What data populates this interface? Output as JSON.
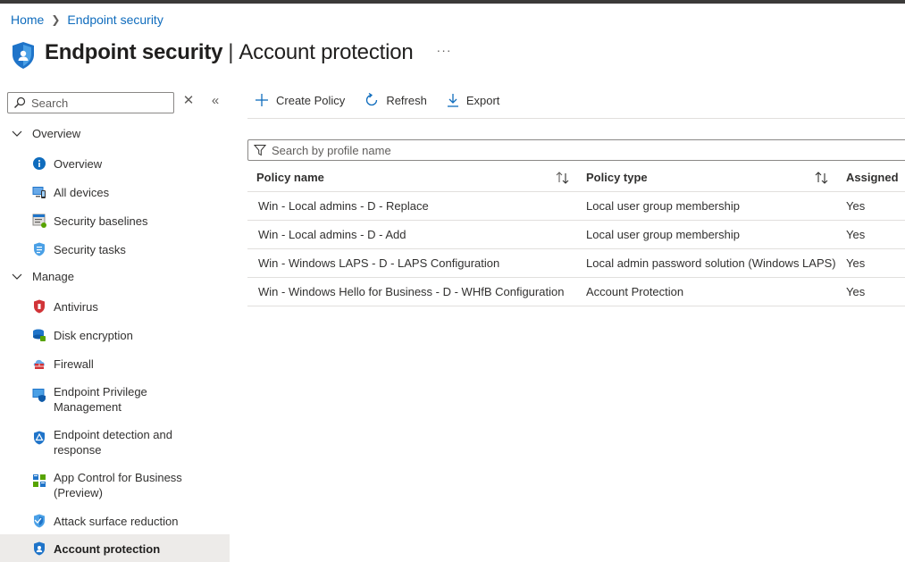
{
  "breadcrumb": {
    "home": "Home",
    "current": "Endpoint security"
  },
  "header": {
    "title": "Endpoint security",
    "subtitle": "Account protection",
    "more": "···"
  },
  "sidebar": {
    "search_placeholder": "Search",
    "groups": {
      "overview": "Overview",
      "manage": "Manage"
    },
    "items": [
      {
        "label": "Overview",
        "icon": "info-icon"
      },
      {
        "label": "All devices",
        "icon": "devices-icon"
      },
      {
        "label": "Security baselines",
        "icon": "baselines-icon"
      },
      {
        "label": "Security tasks",
        "icon": "tasks-icon"
      },
      {
        "label": "Antivirus",
        "icon": "antivirus-icon"
      },
      {
        "label": "Disk encryption",
        "icon": "disk-encryption-icon"
      },
      {
        "label": "Firewall",
        "icon": "firewall-icon"
      },
      {
        "label": "Endpoint Privilege Management",
        "icon": "privilege-icon"
      },
      {
        "label": "Endpoint detection and response",
        "icon": "edr-icon"
      },
      {
        "label": "App Control for Business (Preview)",
        "icon": "app-control-icon"
      },
      {
        "label": "Attack surface reduction",
        "icon": "asr-icon"
      },
      {
        "label": "Account protection",
        "icon": "account-protection-icon"
      }
    ]
  },
  "toolbar": {
    "create": "Create Policy",
    "refresh": "Refresh",
    "export": "Export"
  },
  "filter": {
    "placeholder": "Search by profile name"
  },
  "table": {
    "headers": {
      "name": "Policy name",
      "type": "Policy type",
      "assigned": "Assigned"
    },
    "rows": [
      {
        "name": "Win - Local admins - D - Replace",
        "type": "Local user group membership",
        "assigned": "Yes"
      },
      {
        "name": "Win - Local admins - D - Add",
        "type": "Local user group membership",
        "assigned": "Yes"
      },
      {
        "name": "Win - Windows LAPS - D - LAPS Configuration",
        "type": "Local admin password solution (Windows LAPS)",
        "assigned": "Yes"
      },
      {
        "name": "Win - Windows Hello for Business - D - WHfB Configuration",
        "type": "Account Protection",
        "assigned": "Yes"
      }
    ]
  },
  "colors": {
    "accent": "#0f6cbd",
    "active_bg": "#edebe9"
  }
}
